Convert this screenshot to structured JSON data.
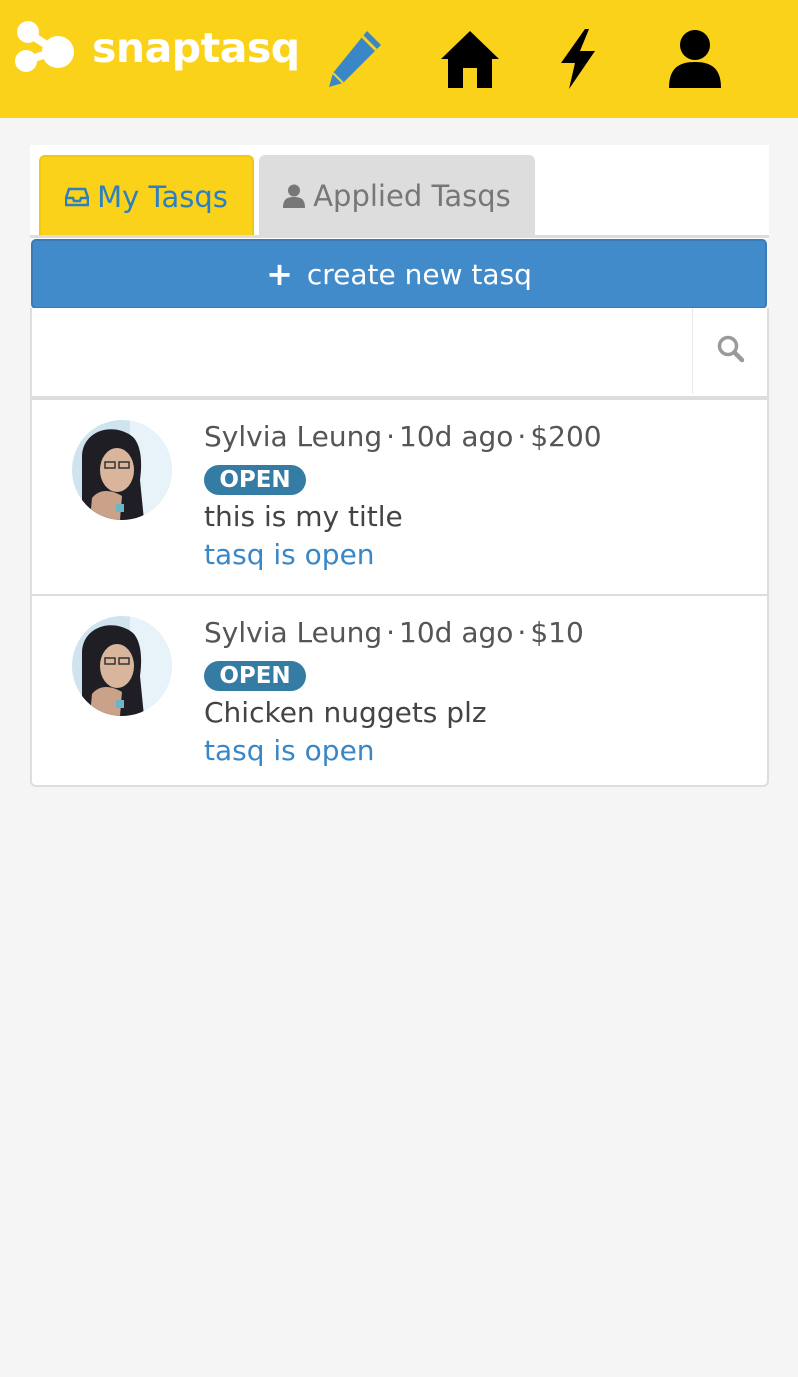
{
  "header": {
    "brand": "snaptasq",
    "icons": {
      "logo": "snaptasq-logo-icon",
      "create": "pencil-icon",
      "home": "home-icon",
      "activity": "bolt-icon",
      "profile": "user-icon"
    },
    "colors": {
      "bar": "#fad219",
      "pencil": "#3a87c8"
    }
  },
  "tabs": [
    {
      "label": "My Tasqs",
      "icon": "inbox-icon",
      "active": true
    },
    {
      "label": "Applied Tasqs",
      "icon": "user-icon",
      "active": false
    }
  ],
  "create_button": {
    "label": "create new tasq",
    "icon": "plus-icon"
  },
  "search": {
    "value": "",
    "placeholder": "",
    "icon": "search-icon"
  },
  "tasqs": [
    {
      "user": "Sylvia Leung",
      "ago": "10d ago",
      "price": "$200",
      "badge": "OPEN",
      "title": "this is my title",
      "status": "tasq is open"
    },
    {
      "user": "Sylvia Leung",
      "ago": "10d ago",
      "price": "$10",
      "badge": "OPEN",
      "title": "Chicken nuggets plz",
      "status": "tasq is open"
    }
  ],
  "separator": "·"
}
